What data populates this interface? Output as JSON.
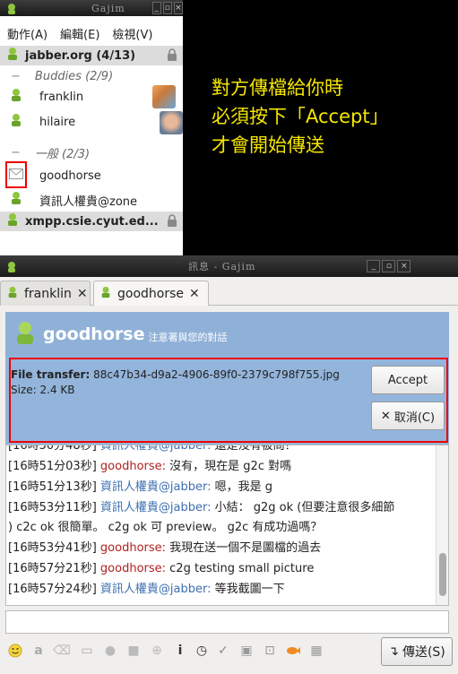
{
  "roster": {
    "title": "Gajim",
    "menu": [
      "動作(A)",
      "編輯(E)",
      "檢視(V)"
    ],
    "accounts": [
      {
        "name": "jabber.org (4/13)"
      },
      {
        "name": "xmpp.csie.cyut.ed..."
      }
    ],
    "groups": [
      {
        "name": "Buddies (2/9)"
      },
      {
        "name": "一般 (2/3)"
      }
    ],
    "contacts": [
      {
        "name": "franklin"
      },
      {
        "name": "hilaire"
      },
      {
        "name": "goodhorse"
      },
      {
        "name": "資訊人權貴@zone"
      }
    ]
  },
  "annotation": {
    "line1": "對方傳檔給你時",
    "line2": "必須按下「Accept」",
    "line3": "才會開始傳送"
  },
  "chat": {
    "title": "訊息 - Gajim",
    "tabs": [
      {
        "label": "franklin"
      },
      {
        "label": "goodhorse"
      }
    ],
    "contact_name": "goodhorse",
    "contact_status": "注意著與您的對話",
    "file_transfer": {
      "label": "File transfer:",
      "filename": "88c47b34-d9a2-4906-89f0-2379c798f755.jpg",
      "size": "Size: 2.4 KB",
      "accept_label": "Accept",
      "cancel_label": "取消(C)"
    },
    "messages": [
      {
        "time": "[16時50分48秒]",
        "nick": "資訊人權貴@jabber:",
        "me": true,
        "text": " 還是沒有被問？"
      },
      {
        "time": "[16時51分03秒]",
        "nick": "goodhorse:",
        "me": false,
        "text": " 沒有，現在是 g2c 對嗎"
      },
      {
        "time": "[16時51分13秒]",
        "nick": "資訊人權貴@jabber:",
        "me": true,
        "text": " 嗯，我是 g"
      },
      {
        "time": "[16時53分11秒]",
        "nick": "資訊人權貴@jabber:",
        "me": true,
        "text": " 小結： g2g ok (但要注意很多細節"
      },
      {
        "time": "",
        "nick": "",
        "me": true,
        "text": ") c2c ok 很簡單。 c2g ok 可 preview。 g2c 有成功過嗎？"
      },
      {
        "time": "[16時53分41秒]",
        "nick": "goodhorse:",
        "me": false,
        "text": " 我現在送一個不是圖檔的過去"
      },
      {
        "time": "[16時57分21秒]",
        "nick": "goodhorse:",
        "me": false,
        "text": " c2g testing small picture"
      },
      {
        "time": "[16時57分24秒]",
        "nick": "資訊人權貴@jabber:",
        "me": true,
        "text": " 等我截圖一下"
      }
    ],
    "send_label": "傳送(S)"
  }
}
